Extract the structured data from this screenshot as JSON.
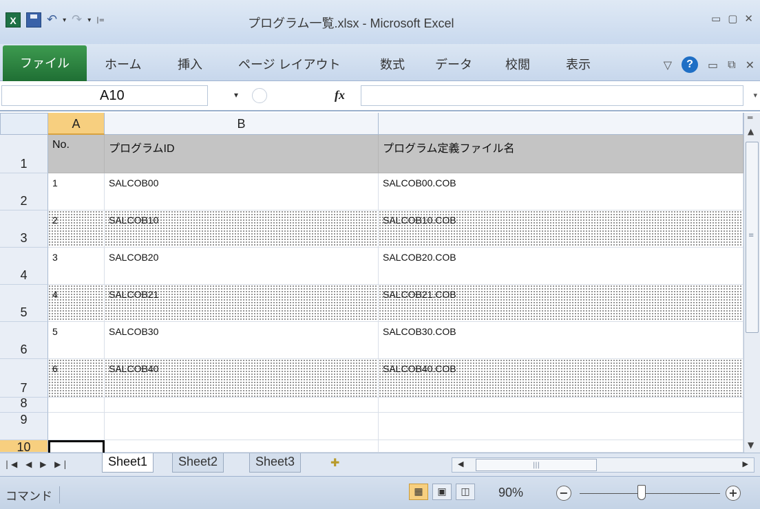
{
  "window": {
    "title": "プログラム一覧.xlsx - Microsoft Excel",
    "controls": [
      "▭",
      "▢",
      "✕"
    ]
  },
  "qat": {
    "app_letter": "X",
    "undo": "↶",
    "redo": "↷",
    "caret": "▾",
    "sep": "|="
  },
  "ribbon": {
    "file_tab": "ファイル",
    "tabs": [
      "ホーム",
      "挿入",
      "ページ レイアウト",
      "数式",
      "データ",
      "校閲",
      "表示"
    ],
    "help": "?",
    "right_glyphs": [
      "▽",
      "▭",
      "⧉",
      "✕"
    ]
  },
  "formula_bar": {
    "name_box": "A10",
    "dropdown": "▾",
    "fx": "fx",
    "formula": "",
    "expand": "▾"
  },
  "grid": {
    "columns": [
      "A",
      "B",
      ""
    ],
    "selected_column": "A",
    "rows": [
      {
        "num": "1",
        "cells": [
          "No.",
          "プログラムID",
          "プログラム定義ファイル名"
        ],
        "style": "header"
      },
      {
        "num": "2",
        "cells": [
          "1",
          "SALCOB00",
          "SALCOB00.COB"
        ],
        "style": "plain"
      },
      {
        "num": "3",
        "cells": [
          "2",
          "SALCOB10",
          "SALCOB10.COB"
        ],
        "style": "dotted"
      },
      {
        "num": "4",
        "cells": [
          "3",
          "SALCOB20",
          "SALCOB20.COB"
        ],
        "style": "plain"
      },
      {
        "num": "5",
        "cells": [
          "4",
          "SALCOB21",
          "SALCOB21.COB"
        ],
        "style": "dotted"
      },
      {
        "num": "6",
        "cells": [
          "5",
          "SALCOB30",
          "SALCOB30.COB"
        ],
        "style": "plain"
      },
      {
        "num": "7",
        "cells": [
          "6",
          "SALCOB40",
          "SALCOB40.COB"
        ],
        "style": "dotted"
      },
      {
        "num": "8",
        "cells": [
          "",
          "",
          ""
        ],
        "style": "plain"
      },
      {
        "num": "9",
        "cells": [
          "",
          "",
          ""
        ],
        "style": "plain"
      },
      {
        "num": "10",
        "cells": [
          "",
          "",
          ""
        ],
        "style": "plain"
      }
    ],
    "active_cell": "A10"
  },
  "sheet_tabs": {
    "nav": "|◀ ◀ ▶ ▶|",
    "tabs": [
      "Sheet1",
      "Sheet2",
      "Sheet3"
    ],
    "active": "Sheet1",
    "new_sheet": "✚"
  },
  "status_bar": {
    "mode": "コマンド",
    "zoom": "90%",
    "zoom_out": "−",
    "zoom_in": "+"
  },
  "colors": {
    "accent_green": "#1f6f34",
    "selected_header": "#f7cf7f",
    "header_row_fill": "#c4c4c4"
  }
}
